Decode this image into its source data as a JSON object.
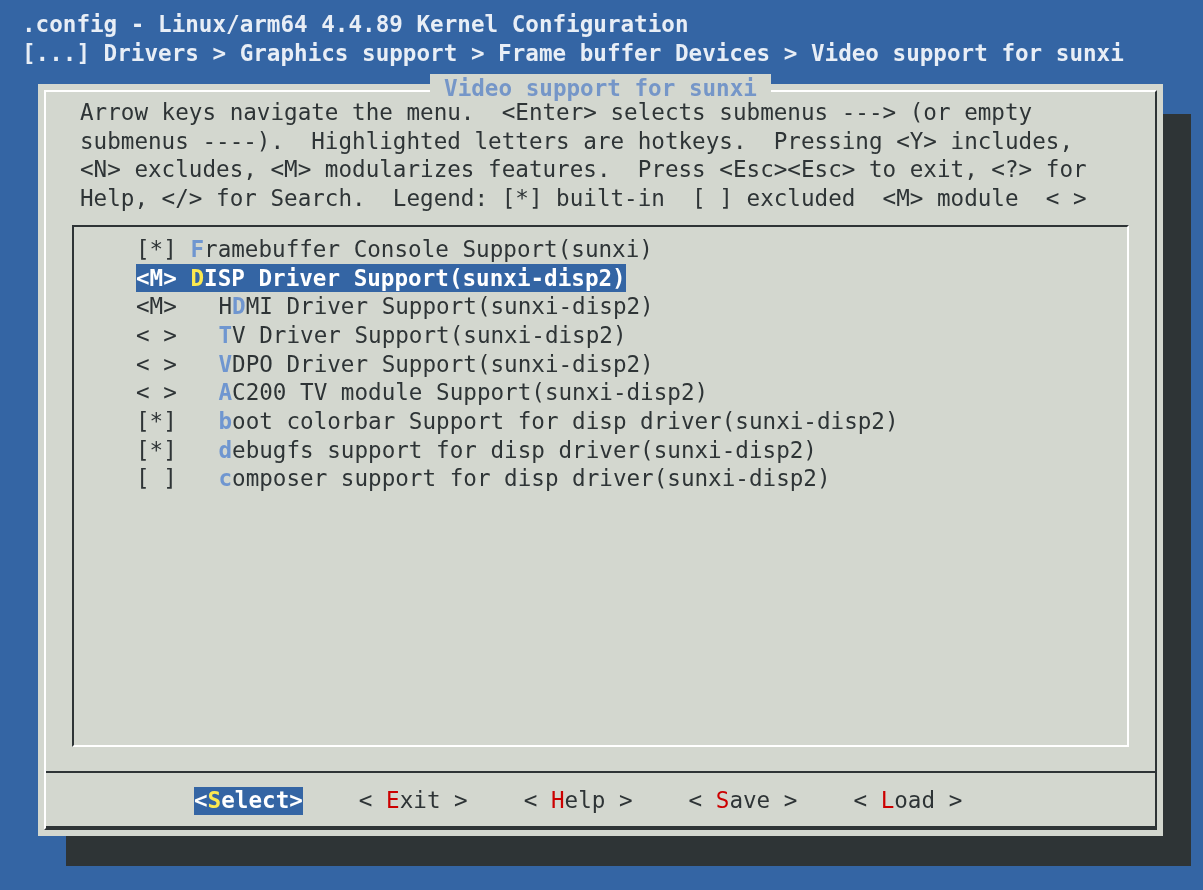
{
  "window": {
    "title": ".config - Linux/arm64 4.4.89 Kernel Configuration"
  },
  "breadcrumb": "[...] Drivers > Graphics support > Frame buffer Devices > Video support for sunxi",
  "dialog": {
    "title": "Video support for sunxi",
    "help_lines": [
      "Arrow keys navigate the menu.  <Enter> selects submenus ---> (or empty",
      "submenus ----).  Highlighted letters are hotkeys.  Pressing <Y> includes,",
      "<N> excludes, <M> modularizes features.  Press <Esc><Esc> to exit, <?> for",
      "Help, </> for Search.  Legend: [*] built-in  [ ] excluded  <M> module  < >"
    ],
    "items": [
      {
        "state": "[*]",
        "hotkey": "F",
        "rest": "ramebuffer Console Support(sunxi)",
        "selected": false
      },
      {
        "state": "<M>",
        "hotkey": "D",
        "rest": "ISP Driver Support(sunxi-disp2)",
        "selected": true,
        "children": [
          {
            "state": "<M>",
            "lead": "H",
            "hotkey": "D",
            "rest": "MI Driver Support(sunxi-disp2)",
            "selected": false
          },
          {
            "state": "< >",
            "hotkey": "T",
            "rest": "V Driver Support(sunxi-disp2)",
            "selected": false
          },
          {
            "state": "< >",
            "hotkey": "V",
            "rest": "DPO Driver Support(sunxi-disp2)",
            "selected": false
          },
          {
            "state": "< >",
            "hotkey": "A",
            "rest": "C200 TV module Support(sunxi-disp2)",
            "selected": false
          },
          {
            "state": "[*]",
            "hotkey": "b",
            "rest": "oot colorbar Support for disp driver(sunxi-disp2)",
            "selected": false
          },
          {
            "state": "[*]",
            "hotkey": "d",
            "rest": "ebugfs support for disp driver(sunxi-disp2)",
            "selected": false
          },
          {
            "state": "[ ]",
            "hotkey": "c",
            "rest": "omposer support for disp driver(sunxi-disp2)",
            "selected": false
          }
        ]
      }
    ],
    "buttons": [
      {
        "open": "<",
        "hotkey": "S",
        "rest": "elect",
        "close": ">",
        "selected": true
      },
      {
        "open": "< ",
        "hotkey": "E",
        "rest": "xit",
        "close": " >",
        "selected": false
      },
      {
        "open": "< ",
        "hotkey": "H",
        "rest": "elp",
        "close": " >",
        "selected": false
      },
      {
        "open": "< ",
        "hotkey": "S",
        "rest": "ave",
        "close": " >",
        "selected": false
      },
      {
        "open": "< ",
        "hotkey": "L",
        "rest": "oad",
        "close": " >",
        "selected": false
      }
    ]
  }
}
